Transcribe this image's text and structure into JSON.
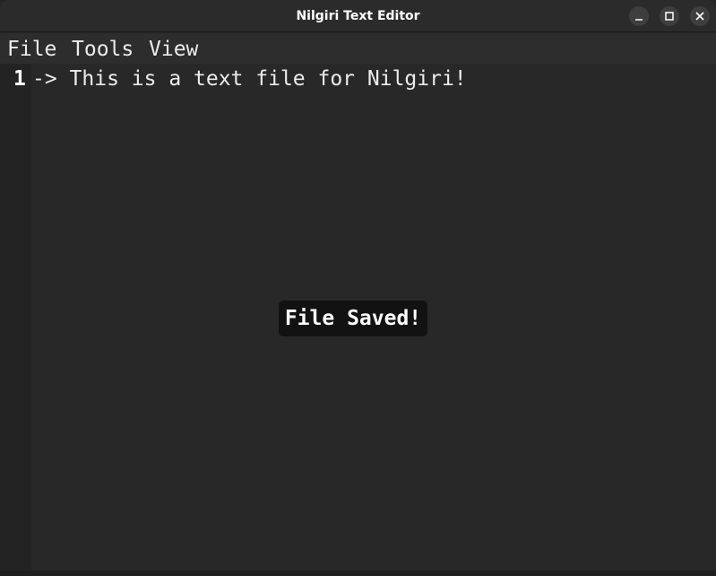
{
  "window": {
    "title": "Nilgiri Text Editor",
    "controls": [
      "minimize-icon",
      "maximize-icon",
      "close-icon"
    ]
  },
  "menubar": {
    "items": [
      {
        "label": "File"
      },
      {
        "label": "Tools"
      },
      {
        "label": "View"
      }
    ]
  },
  "editor": {
    "lines": [
      {
        "number": "1",
        "text": "-> This is a text file for Nilgiri!"
      }
    ]
  },
  "notification": {
    "text": "File Saved!"
  },
  "colors": {
    "background": "#262626",
    "titlebar": "#2b2b2b",
    "menubar": "#2d2d2d",
    "toast": "#121212",
    "text": "#ececec"
  }
}
